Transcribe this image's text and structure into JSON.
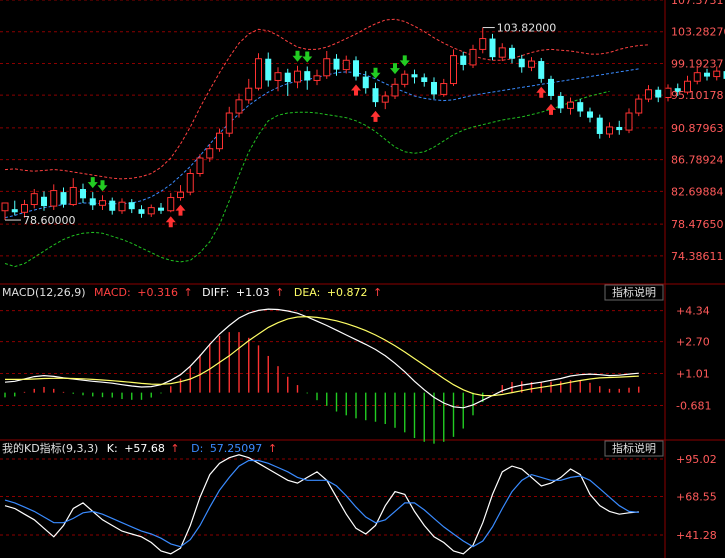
{
  "chart_data": {
    "type": "candlestick",
    "colors": {
      "background": "#000000",
      "grid": "#8b0000",
      "up": "#ff3232",
      "down": "#54ffff",
      "boll_upper": "#ff4040",
      "boll_mid": "#3a8bff",
      "boll_lower": "#20c020",
      "diff": "#ffffff",
      "dea": "#ffff66",
      "k": "#ffffff",
      "d": "#3a8bff",
      "tick_text": "#ff5a5a",
      "annotation": "#e0e0e0"
    },
    "price_panel": {
      "y_ticks": [
        "107.3731",
        "103.28270",
        "99.19237",
        "95.10178",
        "90.87963",
        "86.78924",
        "82.69884",
        "78.47650",
        "74.38611"
      ],
      "ylim": [
        72.3,
        107.3731
      ],
      "annotations": {
        "high_label": "103.82000",
        "low_label": "78.60000"
      },
      "candles": [
        [
          80.2,
          81.2,
          80.6,
          79.0
        ],
        [
          80.4,
          80.0,
          81.5,
          79.6
        ],
        [
          80.0,
          81.0,
          81.6,
          79.3
        ],
        [
          81.0,
          82.4,
          83.0,
          80.5
        ],
        [
          82.0,
          80.8,
          82.7,
          80.2
        ],
        [
          80.8,
          82.8,
          83.6,
          80.3
        ],
        [
          82.6,
          81.0,
          83.2,
          80.6
        ],
        [
          81.0,
          83.2,
          84.4,
          80.8
        ],
        [
          83.0,
          81.8,
          83.7,
          81.2
        ],
        [
          81.8,
          80.9,
          82.6,
          80.3
        ],
        [
          80.9,
          81.5,
          82.2,
          80.3
        ],
        [
          81.5,
          80.2,
          81.9,
          79.7
        ],
        [
          80.2,
          81.3,
          81.8,
          79.8
        ],
        [
          81.3,
          80.4,
          81.7,
          79.9
        ],
        [
          80.4,
          79.8,
          80.9,
          79.3
        ],
        [
          79.8,
          80.6,
          81.0,
          79.4
        ],
        [
          80.6,
          80.2,
          81.2,
          79.8
        ],
        [
          80.2,
          81.9,
          82.5,
          80.0
        ],
        [
          81.9,
          82.6,
          83.5,
          81.5
        ],
        [
          82.6,
          85.0,
          85.6,
          82.2
        ],
        [
          85.0,
          87.0,
          87.5,
          84.6
        ],
        [
          87.0,
          88.2,
          88.8,
          86.5
        ],
        [
          88.2,
          90.2,
          90.8,
          87.8
        ],
        [
          90.2,
          92.8,
          93.6,
          89.7
        ],
        [
          92.8,
          94.5,
          95.3,
          92.2
        ],
        [
          94.5,
          96.0,
          97.2,
          94.0
        ],
        [
          96.0,
          99.8,
          100.5,
          95.7
        ],
        [
          99.8,
          97.0,
          100.6,
          96.2
        ],
        [
          97.0,
          98.0,
          98.7,
          95.6
        ],
        [
          98.0,
          96.8,
          98.5,
          95.0
        ],
        [
          96.8,
          98.2,
          98.9,
          96.0
        ],
        [
          98.2,
          97.0,
          98.8,
          95.8
        ],
        [
          97.0,
          97.6,
          98.4,
          96.4
        ],
        [
          97.6,
          99.8,
          100.8,
          97.2
        ],
        [
          99.8,
          98.4,
          100.4,
          97.6
        ],
        [
          98.4,
          99.6,
          100.2,
          97.9
        ],
        [
          99.6,
          97.5,
          100.1,
          97.0
        ],
        [
          97.5,
          96.0,
          98.2,
          95.3
        ],
        [
          96.0,
          94.2,
          96.7,
          93.6
        ],
        [
          94.2,
          95.0,
          95.6,
          93.3
        ],
        [
          95.0,
          96.5,
          97.3,
          94.6
        ],
        [
          96.5,
          97.8,
          98.3,
          96.1
        ],
        [
          97.8,
          97.4,
          98.4,
          96.6
        ],
        [
          97.4,
          96.8,
          97.9,
          96.2
        ],
        [
          96.8,
          95.2,
          97.4,
          94.6
        ],
        [
          95.2,
          96.6,
          97.2,
          94.9
        ],
        [
          96.6,
          100.2,
          101.0,
          96.3
        ],
        [
          100.2,
          99.0,
          100.7,
          98.3
        ],
        [
          99.0,
          101.0,
          101.6,
          98.6
        ],
        [
          101.0,
          102.4,
          103.82,
          100.5
        ],
        [
          102.4,
          100.0,
          103.0,
          99.6
        ],
        [
          100.0,
          101.2,
          101.8,
          99.5
        ],
        [
          101.2,
          99.8,
          101.6,
          99.2
        ],
        [
          99.8,
          98.7,
          100.3,
          98.0
        ],
        [
          98.7,
          99.5,
          100.0,
          98.2
        ],
        [
          99.5,
          97.2,
          99.9,
          96.7
        ],
        [
          97.2,
          95.0,
          97.6,
          94.5
        ],
        [
          95.0,
          93.4,
          95.5,
          92.8
        ],
        [
          93.4,
          94.2,
          94.8,
          92.6
        ],
        [
          94.2,
          93.0,
          94.6,
          92.3
        ],
        [
          93.0,
          92.2,
          93.5,
          91.6
        ],
        [
          92.2,
          90.1,
          92.6,
          89.5
        ],
        [
          90.1,
          91.0,
          91.6,
          89.6
        ],
        [
          91.0,
          90.6,
          91.8,
          90.0
        ],
        [
          90.6,
          92.8,
          93.4,
          90.2
        ],
        [
          92.8,
          94.6,
          95.2,
          92.4
        ],
        [
          94.6,
          95.8,
          96.4,
          94.2
        ],
        [
          95.8,
          94.8,
          96.2,
          94.2
        ],
        [
          94.8,
          96.0,
          96.5,
          94.3
        ],
        [
          96.0,
          95.5,
          96.6,
          95.0
        ],
        [
          95.5,
          96.9,
          97.6,
          95.2
        ],
        [
          96.9,
          98.0,
          98.9,
          96.5
        ],
        [
          98.0,
          97.5,
          98.5,
          97.0
        ],
        [
          97.5,
          98.2,
          98.8,
          97.0
        ],
        [
          98.2,
          97.2,
          98.6,
          96.8
        ],
        [
          97.2,
          98.0,
          98.7,
          96.9
        ],
        [
          98.0,
          97.0,
          98.5,
          96.5
        ],
        [
          97.0,
          98.5,
          99.1,
          96.8
        ],
        [
          98.5,
          99.4,
          100.0,
          98.0
        ],
        [
          99.4,
          98.6,
          100.0,
          98.2
        ],
        [
          98.6,
          99.8,
          100.3,
          98.3
        ],
        [
          99.8,
          98.4,
          100.2,
          98.0
        ],
        [
          98.4,
          97.6,
          98.9,
          97.1
        ],
        [
          97.6,
          98.8,
          99.4,
          97.2
        ],
        [
          98.8,
          99.4,
          100.4,
          95.0
        ],
        [
          99.4,
          99.6,
          103.3,
          98.5
        ]
      ],
      "boll_upper": [
        85.5,
        85.6,
        85.4,
        85.3,
        85.4,
        85.5,
        85.4,
        85.2,
        85.0,
        84.8,
        84.6,
        84.4,
        84.3,
        84.4,
        84.6,
        85.0,
        85.8,
        87.0,
        88.8,
        91.0,
        93.5,
        95.8,
        98.0,
        100.0,
        101.8,
        103.0,
        103.6,
        103.4,
        102.8,
        102.0,
        101.3,
        101.0,
        101.0,
        101.3,
        101.8,
        102.4,
        103.0,
        103.7,
        104.3,
        104.8,
        104.9,
        104.6,
        104.0,
        103.3,
        102.5,
        101.8,
        101.2,
        100.7,
        100.2,
        99.8,
        99.6,
        99.6,
        99.8,
        100.2,
        100.6,
        100.9,
        101.0,
        100.9,
        100.8,
        100.6,
        100.4,
        100.4,
        100.6,
        101.0,
        101.3,
        101.5,
        101.6
      ],
      "boll_mid": [
        79.3,
        79.6,
        80.0,
        80.3,
        80.6,
        80.8,
        81.0,
        81.1,
        81.2,
        81.2,
        81.1,
        81.1,
        81.1,
        81.2,
        81.5,
        82.0,
        82.7,
        83.6,
        84.7,
        85.9,
        87.3,
        88.8,
        90.2,
        91.5,
        92.7,
        93.8,
        94.7,
        95.5,
        96.1,
        96.6,
        96.9,
        97.1,
        97.4,
        97.7,
        98.0,
        98.1,
        98.0,
        97.7,
        97.2,
        96.6,
        96.0,
        95.5,
        95.0,
        94.7,
        94.5,
        94.4,
        94.5,
        94.8,
        95.1,
        95.3,
        95.5,
        95.7,
        95.9,
        96.1,
        96.3,
        96.5,
        96.7,
        96.9,
        97.1,
        97.3,
        97.5,
        97.7,
        97.9,
        98.1,
        98.3,
        98.5
      ],
      "boll_lower": [
        73.4,
        73.0,
        73.4,
        74.2,
        75.0,
        75.8,
        76.5,
        77.0,
        77.3,
        77.4,
        77.3,
        76.9,
        76.5,
        76.0,
        75.4,
        74.8,
        74.2,
        73.8,
        73.6,
        73.8,
        74.8,
        76.2,
        78.4,
        81.5,
        84.8,
        87.8,
        90.0,
        91.8,
        92.5,
        92.8,
        92.9,
        92.9,
        92.8,
        92.6,
        92.4,
        92.2,
        91.8,
        91.2,
        90.4,
        89.4,
        88.4,
        87.8,
        87.6,
        87.8,
        88.4,
        89.2,
        90.0,
        90.6,
        91.0,
        91.3,
        91.6,
        91.9,
        92.1,
        92.3,
        92.6,
        92.9,
        93.3,
        93.7,
        94.2,
        94.6,
        95.0,
        95.3,
        95.6
      ]
    },
    "macd_panel": {
      "header": {
        "name": "MACD(12,26,9)",
        "macd_label": "MACD:",
        "macd_value": "+0.316",
        "diff_label": "DIFF:",
        "diff_value": "+1.03",
        "dea_label": "DEA:",
        "dea_value": "+0.872",
        "arrow": "↑"
      },
      "button": "指标说明",
      "y_ticks": [
        "+4.34",
        "+2.70",
        "+1.01",
        "-0.681"
      ],
      "ylim": [
        -2.4,
        4.9
      ],
      "diff": [
        0.55,
        0.6,
        0.72,
        0.85,
        0.9,
        0.86,
        0.78,
        0.72,
        0.66,
        0.6,
        0.55,
        0.5,
        0.42,
        0.35,
        0.3,
        0.32,
        0.42,
        0.65,
        0.95,
        1.4,
        1.95,
        2.55,
        3.1,
        3.55,
        3.95,
        4.2,
        4.35,
        4.42,
        4.4,
        4.32,
        4.2,
        4.0,
        3.78,
        3.55,
        3.3,
        3.05,
        2.8,
        2.55,
        2.28,
        1.95,
        1.55,
        1.1,
        0.6,
        0.15,
        -0.25,
        -0.55,
        -0.75,
        -0.8,
        -0.65,
        -0.4,
        -0.15,
        0.1,
        0.28,
        0.4,
        0.48,
        0.55,
        0.65,
        0.75,
        0.88,
        0.95,
        0.98,
        0.95,
        0.9,
        0.92,
        0.98,
        1.03
      ],
      "dea": [
        0.7,
        0.7,
        0.7,
        0.72,
        0.75,
        0.76,
        0.76,
        0.75,
        0.73,
        0.7,
        0.67,
        0.63,
        0.59,
        0.54,
        0.49,
        0.45,
        0.44,
        0.48,
        0.58,
        0.72,
        0.95,
        1.25,
        1.6,
        1.95,
        2.35,
        2.75,
        3.1,
        3.45,
        3.7,
        3.9,
        4.0,
        4.02,
        3.98,
        3.9,
        3.8,
        3.65,
        3.48,
        3.28,
        3.05,
        2.78,
        2.48,
        2.15,
        1.8,
        1.45,
        1.1,
        0.75,
        0.42,
        0.15,
        -0.05,
        -0.15,
        -0.16,
        -0.1,
        0.0,
        0.1,
        0.2,
        0.28,
        0.36,
        0.45,
        0.55,
        0.64,
        0.72,
        0.78,
        0.8,
        0.82,
        0.85,
        0.872
      ],
      "hist": [
        -0.25,
        -0.2,
        0.04,
        0.2,
        0.3,
        0.2,
        0.04,
        -0.06,
        -0.14,
        -0.2,
        -0.24,
        -0.26,
        -0.34,
        -0.38,
        -0.38,
        -0.26,
        -0.04,
        0.34,
        0.74,
        1.36,
        2.0,
        2.6,
        3.0,
        3.2,
        3.2,
        2.9,
        2.5,
        1.94,
        1.4,
        0.84,
        0.4,
        -0.04,
        -0.4,
        -0.7,
        -1.0,
        -1.2,
        -1.36,
        -1.46,
        -1.54,
        -1.66,
        -1.86,
        -2.1,
        -2.4,
        -2.6,
        -2.7,
        -2.6,
        -2.34,
        -1.9,
        -1.2,
        -0.5,
        0.02,
        0.4,
        0.56,
        0.6,
        0.56,
        0.54,
        0.58,
        0.6,
        0.66,
        0.62,
        0.52,
        0.34,
        0.2,
        0.2,
        0.26,
        0.316
      ]
    },
    "kd_panel": {
      "header": {
        "name": "我的KD指标(9,3,3)",
        "k_label": "K:",
        "k_value": "+57.68",
        "d_label": "D:",
        "d_value": "57.25097",
        "arrow": "↑"
      },
      "button": "指标说明",
      "y_ticks": [
        "+95.02",
        "+68.55",
        "+41.28"
      ],
      "ylim": [
        25.0,
        100.0
      ],
      "k": [
        62,
        60,
        56,
        52,
        46,
        40,
        48,
        60,
        64,
        58,
        52,
        48,
        44,
        42,
        40,
        36,
        30,
        28,
        32,
        48,
        68,
        84,
        92,
        96,
        98,
        96,
        92,
        88,
        84,
        80,
        78,
        82,
        86,
        80,
        68,
        56,
        46,
        42,
        48,
        62,
        72,
        70,
        58,
        48,
        40,
        36,
        30,
        28,
        34,
        50,
        70,
        86,
        90,
        88,
        82,
        76,
        78,
        82,
        88,
        84,
        70,
        62,
        58,
        56,
        57,
        57.68
      ],
      "d": [
        66,
        64,
        61,
        58,
        54,
        50,
        50,
        53,
        57,
        58,
        56,
        53,
        50,
        47,
        44,
        42,
        39,
        35,
        33,
        38,
        48,
        61,
        73,
        82,
        90,
        94,
        94,
        92,
        89,
        86,
        82,
        80,
        80,
        80,
        76,
        69,
        61,
        54,
        50,
        52,
        58,
        64,
        64,
        59,
        53,
        47,
        42,
        37,
        33,
        37,
        47,
        60,
        72,
        80,
        84,
        82,
        80,
        80,
        82,
        83,
        80,
        74,
        68,
        62,
        58,
        57.25
      ]
    }
  }
}
